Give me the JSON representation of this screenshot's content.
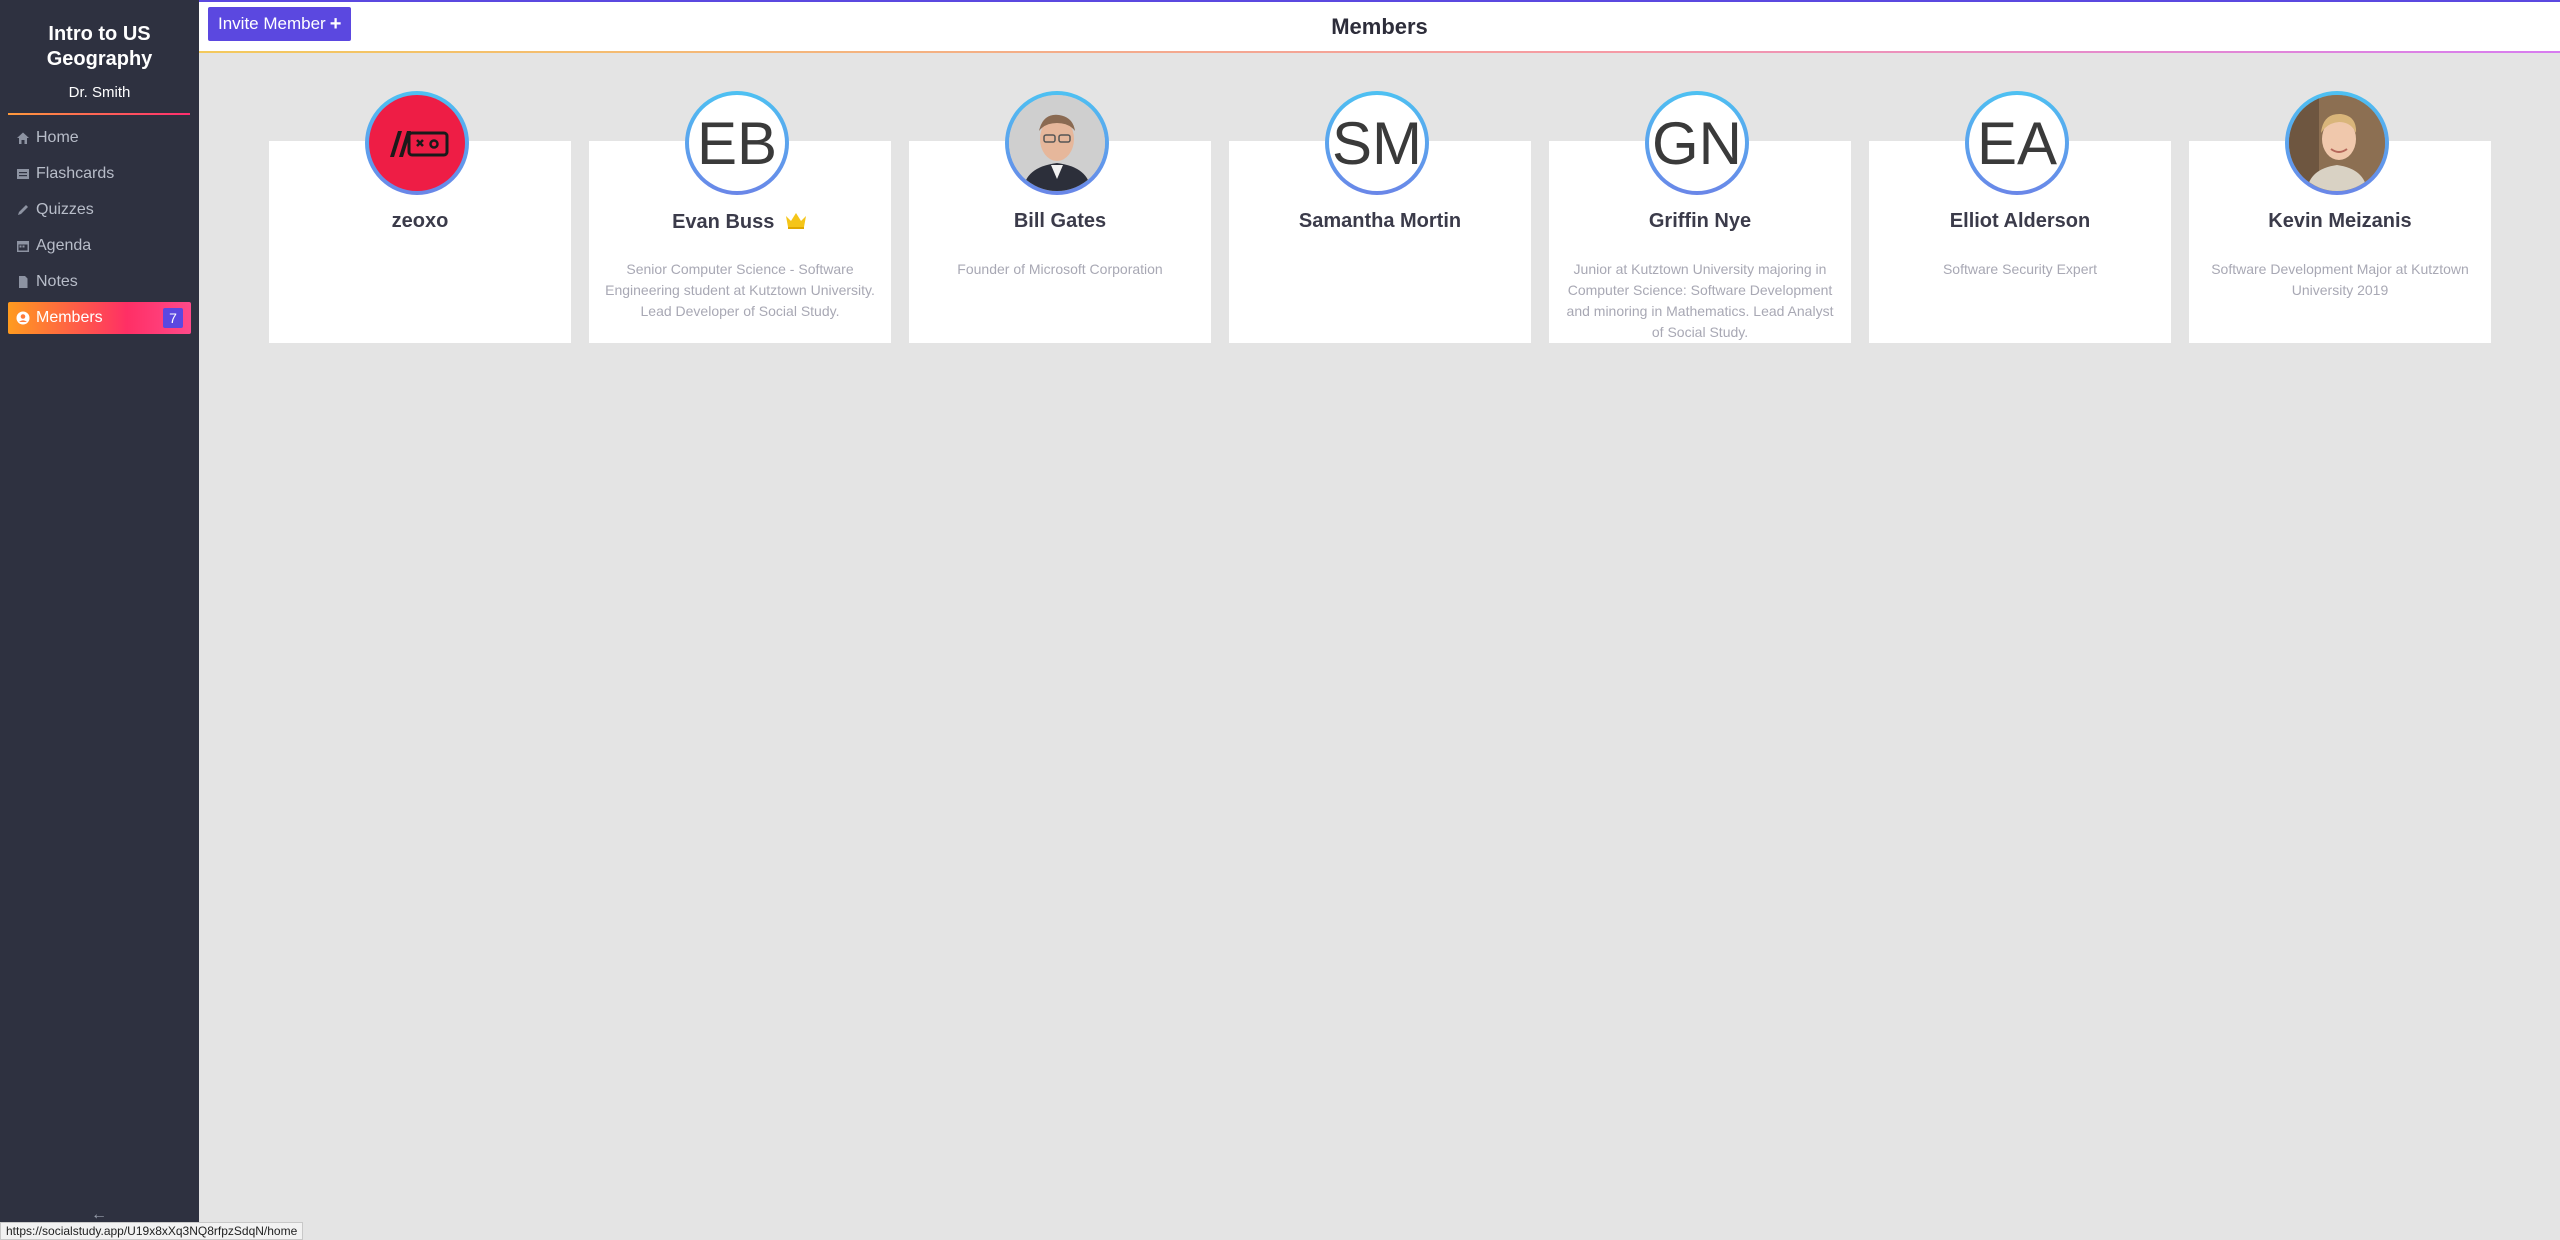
{
  "sidebar": {
    "course_title": "Intro to US Geography",
    "teacher": "Dr. Smith",
    "items": [
      {
        "label": "Home",
        "icon": "home-icon"
      },
      {
        "label": "Flashcards",
        "icon": "flashcards-icon"
      },
      {
        "label": "Quizzes",
        "icon": "pencil-icon"
      },
      {
        "label": "Agenda",
        "icon": "calendar-icon"
      },
      {
        "label": "Notes",
        "icon": "notes-icon"
      },
      {
        "label": "Members",
        "icon": "user-circle-icon",
        "active": true,
        "badge": "7"
      }
    ]
  },
  "header": {
    "invite_label": "Invite Member",
    "title": "Members"
  },
  "members": [
    {
      "name": "zeoxo",
      "initials": "",
      "bio": "",
      "avatar": "gamepad-logo"
    },
    {
      "name": "Evan Buss",
      "initials": "EB",
      "bio": "Senior Computer Science - Software Engineering student at Kutztown University. Lead Developer of Social Study.",
      "owner": true
    },
    {
      "name": "Bill Gates",
      "initials": "",
      "bio": "Founder of Microsoft Corporation",
      "avatar": "photo"
    },
    {
      "name": "Samantha Mortin",
      "initials": "SM",
      "bio": ""
    },
    {
      "name": "Griffin Nye",
      "initials": "GN",
      "bio": "Junior at Kutztown University majoring in Computer Science: Software Development and minoring in Mathematics. Lead Analyst of Social Study."
    },
    {
      "name": "Elliot Alderson",
      "initials": "EA",
      "bio": "Software Security Expert"
    },
    {
      "name": "Kevin Meizanis",
      "initials": "",
      "bio": "Software Development Major at Kutztown University 2019",
      "avatar": "photo"
    }
  ],
  "status_url": "https://socialstudy.app/U19x8xXq3NQ8rfpzSdqN/home",
  "colors": {
    "accent": "#5b48e0",
    "sidebar_bg": "#2e3140",
    "active_gradient_start": "#ff9b1f",
    "active_gradient_end": "#ff2f65",
    "avatar_ring": "#4dc1f2"
  }
}
